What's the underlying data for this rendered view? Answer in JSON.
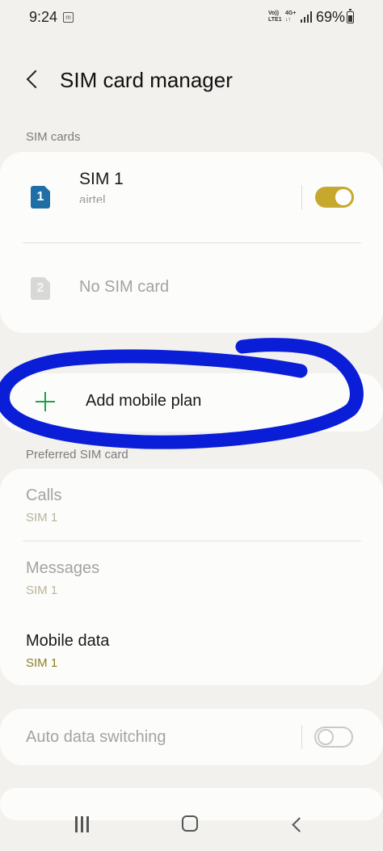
{
  "status_bar": {
    "time": "9:24",
    "notification_icon": "m",
    "volte": "Vo))",
    "lte": "LTE1",
    "net_type": "4G+",
    "net_arrows": "↓↑",
    "battery": "69%"
  },
  "header": {
    "title": "SIM card manager",
    "back_icon": "chevron-left-icon"
  },
  "sim_cards": {
    "section_label": "SIM cards",
    "items": [
      {
        "slot": "1",
        "name": "SIM 1",
        "carrier": "airtel",
        "enabled": true,
        "color": "#1f6fa6"
      },
      {
        "slot": "2",
        "name": "No SIM card"
      }
    ]
  },
  "add_plan": {
    "label": "Add mobile plan",
    "icon": "plus-icon",
    "icon_color": "#19a34a"
  },
  "preferred": {
    "section_label": "Preferred SIM card",
    "items": [
      {
        "title": "Calls",
        "value": "SIM 1"
      },
      {
        "title": "Messages",
        "value": "SIM 1"
      },
      {
        "title": "Mobile data",
        "value": "SIM 1"
      }
    ]
  },
  "auto_switch": {
    "label": "Auto data switching",
    "enabled": false
  },
  "annotation": {
    "color": "#0a1ed8"
  },
  "colors": {
    "toggle_on": "#c6a92c",
    "accent_sub": "#8c7f22",
    "background": "#f2f1ee"
  }
}
